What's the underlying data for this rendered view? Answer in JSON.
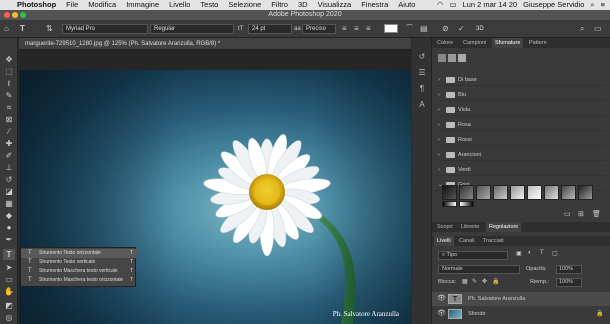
{
  "menubar": {
    "items": [
      "Photoshop",
      "File",
      "Modifica",
      "Immagine",
      "Livello",
      "Testo",
      "Selezione",
      "Filtro",
      "3D",
      "Visualizza",
      "Finestra",
      "Aiuto"
    ],
    "datetime": "Lun 2 mar 14 20",
    "user": "Giuseppe Servidio"
  },
  "window": {
    "title": "Adobe Photoshop 2020"
  },
  "options": {
    "font_family": "Myriad Pro",
    "font_style": "Regular",
    "font_size": "24 pt",
    "antialias": "Preciso",
    "size_value": "3D"
  },
  "document": {
    "tab_title": "marguerite-729510_1280.jpg @ 125% (Ph. Salvatore Aranzulla, RGB/8) *",
    "credit": "Ph. Salvatore Aranzulla"
  },
  "flyout": {
    "items": [
      {
        "label": "Strumento Testo orizzontale",
        "key": "T"
      },
      {
        "label": "Strumento Testo verticale",
        "key": "T"
      },
      {
        "label": "Strumento Maschera testo verticale",
        "key": "T"
      },
      {
        "label": "Strumento Maschera testo orizzontale",
        "key": "T"
      }
    ]
  },
  "panel_top": {
    "tabs": [
      "Colore",
      "Campioni",
      "Sfumature",
      "Pattern"
    ],
    "active_tab": "Sfumature",
    "groups": [
      "Di base",
      "Blu",
      "Viola",
      "Rosa",
      "Rossi",
      "Arancioni",
      "Verdi",
      "Grigi"
    ]
  },
  "panel_mid": {
    "tabs": [
      "Scopri",
      "Librerie",
      "Regolazioni"
    ],
    "active_tab": "Regolazioni"
  },
  "layers": {
    "tabs": [
      "Livelli",
      "Canali",
      "Tracciati"
    ],
    "search_placeholder": "Tipo",
    "blend_mode": "Normale",
    "opacity_label": "Opacità:",
    "opacity_value": "100%",
    "lock_label": "Blocca:",
    "fill_label": "Riemp.:",
    "fill_value": "100%",
    "rows": [
      {
        "name": "Ph. Salvatore Aranzulla",
        "type": "T"
      },
      {
        "name": "Sfondo",
        "type": "image"
      }
    ]
  },
  "colors": {
    "accent": "#1473e6",
    "photo_bg": "#2a5f7a",
    "petal": "#f5f5f5",
    "center": "#e8c21a"
  }
}
